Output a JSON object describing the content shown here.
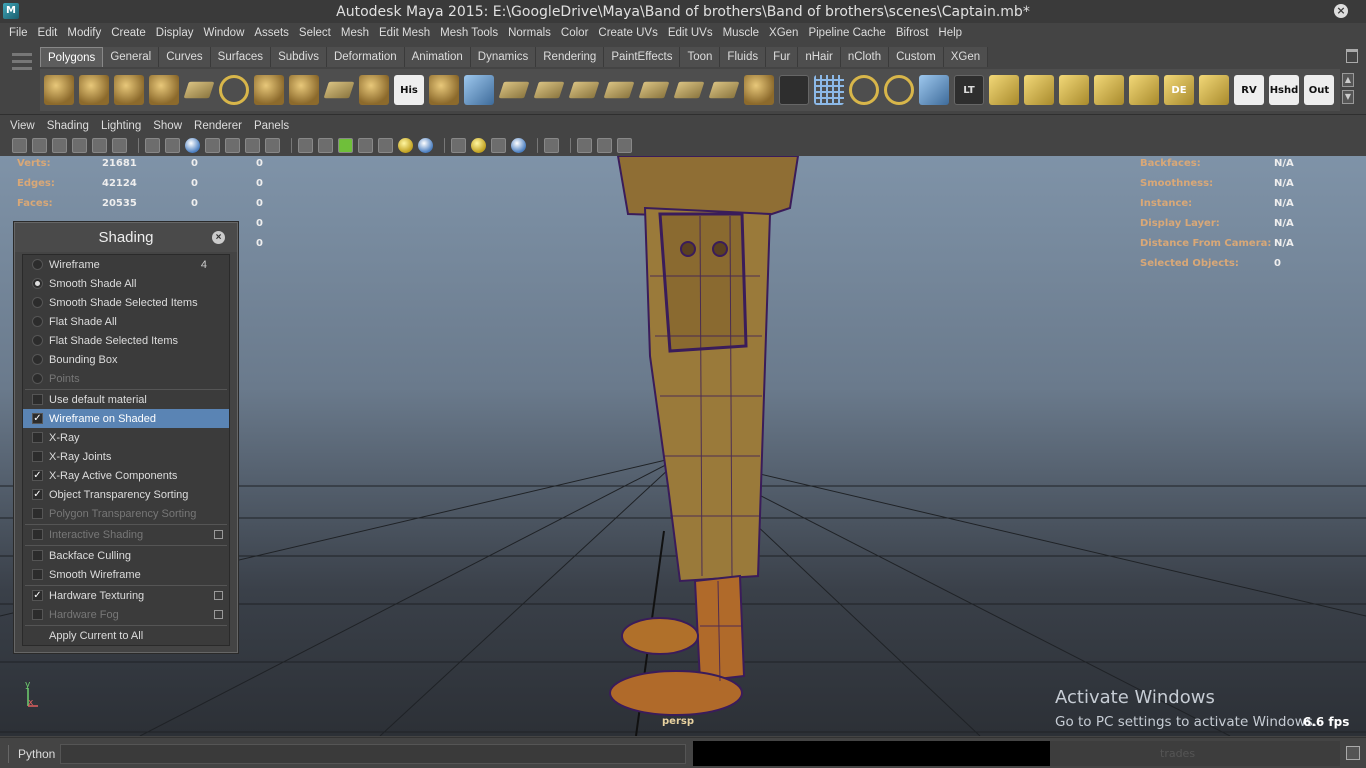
{
  "titlebar": {
    "title": "Autodesk Maya 2015: E:\\GoogleDrive\\Maya\\Band of brothers\\Band of brothers\\scenes\\Captain.mb*",
    "app_icon": "M"
  },
  "menubar": [
    "File",
    "Edit",
    "Modify",
    "Create",
    "Display",
    "Window",
    "Assets",
    "Select",
    "Mesh",
    "Edit Mesh",
    "Mesh Tools",
    "Normals",
    "Color",
    "Create UVs",
    "Edit UVs",
    "Muscle",
    "XGen",
    "Pipeline Cache",
    "Bifrost",
    "Help"
  ],
  "shelf": {
    "tabs": [
      "Polygons",
      "General",
      "Curves",
      "Surfaces",
      "Subdivs",
      "Deformation",
      "Animation",
      "Dynamics",
      "Rendering",
      "PaintEffects",
      "Toon",
      "Fluids",
      "Fur",
      "nHair",
      "nCloth",
      "Custom",
      "XGen"
    ],
    "active_tab": "Polygons",
    "icons": [
      {
        "name": "poly-sphere-icon",
        "style": "shape",
        "label": ""
      },
      {
        "name": "poly-cube-icon",
        "style": "shape",
        "label": ""
      },
      {
        "name": "poly-cylinder-icon",
        "style": "shape",
        "label": ""
      },
      {
        "name": "poly-cone-icon",
        "style": "shape",
        "label": ""
      },
      {
        "name": "poly-plane-icon",
        "style": "flat",
        "label": ""
      },
      {
        "name": "poly-torus-icon",
        "style": "ring",
        "label": ""
      },
      {
        "name": "poly-pyramid-icon",
        "style": "shape",
        "label": ""
      },
      {
        "name": "poly-pipe-icon",
        "style": "shape",
        "label": ""
      },
      {
        "name": "poly-helix-icon",
        "style": "flat",
        "label": ""
      },
      {
        "name": "poly-soccer-ball-icon",
        "style": "shape",
        "label": ""
      },
      {
        "name": "history-icon",
        "style": "text",
        "label": "His"
      },
      {
        "name": "combine-icon",
        "style": "shape",
        "label": ""
      },
      {
        "name": "separate-icon",
        "style": "blue",
        "label": ""
      },
      {
        "name": "extract-icon",
        "style": "flat",
        "label": ""
      },
      {
        "name": "booleans-icon",
        "style": "flat",
        "label": ""
      },
      {
        "name": "smooth-icon",
        "style": "flat",
        "label": ""
      },
      {
        "name": "average-vertices-icon",
        "style": "flat",
        "label": ""
      },
      {
        "name": "transfer-icon",
        "style": "flat",
        "label": ""
      },
      {
        "name": "extrude-icon",
        "style": "flat",
        "label": ""
      },
      {
        "name": "bridge-icon",
        "style": "flat",
        "label": ""
      },
      {
        "name": "merge-icon",
        "style": "shape",
        "label": ""
      },
      {
        "name": "split-icon",
        "style": "dark",
        "label": ""
      },
      {
        "name": "grid-icon",
        "style": "grid",
        "label": ""
      },
      {
        "name": "snap-icon",
        "style": "ring",
        "label": ""
      },
      {
        "name": "rotate-icon",
        "style": "ring",
        "label": ""
      },
      {
        "name": "move-icon",
        "style": "blue",
        "label": ""
      },
      {
        "name": "lasso-tool-icon",
        "style": "dark",
        "label": "LT"
      },
      {
        "name": "uv-map-icon",
        "style": "gold",
        "label": ""
      },
      {
        "name": "uv-planar-icon",
        "style": "gold",
        "label": ""
      },
      {
        "name": "uv-cylinder-icon",
        "style": "gold",
        "label": ""
      },
      {
        "name": "uv-sphere-icon",
        "style": "gold",
        "label": ""
      },
      {
        "name": "uv-auto-icon",
        "style": "gold",
        "label": ""
      },
      {
        "name": "display-edges-icon",
        "style": "gold",
        "label": "DE"
      },
      {
        "name": "uv-layout-icon",
        "style": "gold",
        "label": ""
      },
      {
        "name": "reverse-normals-icon",
        "style": "text",
        "label": "RV"
      },
      {
        "name": "hard-shade-icon",
        "style": "text",
        "label": "Hshd"
      },
      {
        "name": "outliner-icon",
        "style": "text",
        "label": "Out"
      }
    ]
  },
  "panel_menu": [
    "View",
    "Shading",
    "Lighting",
    "Show",
    "Renderer",
    "Panels"
  ],
  "hud_left": [
    {
      "label": "Verts:",
      "v1": "21681",
      "v2": "0",
      "v3": "0"
    },
    {
      "label": "Edges:",
      "v1": "42124",
      "v2": "0",
      "v3": "0"
    },
    {
      "label": "Faces:",
      "v1": "20535",
      "v2": "0",
      "v3": "0"
    },
    {
      "label": "",
      "v1": "",
      "v2": "",
      "v3": "0"
    },
    {
      "label": "",
      "v1": "",
      "v2": "",
      "v3": "0"
    }
  ],
  "hud_right": [
    {
      "label": "Backfaces:",
      "value": "N/A"
    },
    {
      "label": "Smoothness:",
      "value": "N/A"
    },
    {
      "label": "Instance:",
      "value": "N/A"
    },
    {
      "label": "Display Layer:",
      "value": "N/A"
    },
    {
      "label": "Distance From Camera:",
      "value": "N/A"
    },
    {
      "label": "Selected Objects:",
      "value": "0"
    }
  ],
  "camera_label": "persp",
  "watermark": {
    "title": "Activate Windows",
    "subtitle": "Go to PC settings to activate Windows."
  },
  "fps": "6.6 fps",
  "axis": {
    "y": "y",
    "x": "x"
  },
  "shading_panel": {
    "title": "Shading",
    "items": [
      {
        "label": "Wireframe",
        "marker": "radio",
        "checked": false,
        "shortcut": "4",
        "disabled": false,
        "option_box": false
      },
      {
        "label": "Smooth Shade All",
        "marker": "radio",
        "checked": true,
        "shortcut": "",
        "disabled": false,
        "option_box": false
      },
      {
        "label": "Smooth Shade Selected Items",
        "marker": "radio",
        "checked": false,
        "shortcut": "",
        "disabled": false,
        "option_box": false
      },
      {
        "label": "Flat Shade All",
        "marker": "radio",
        "checked": false,
        "shortcut": "",
        "disabled": false,
        "option_box": false
      },
      {
        "label": "Flat Shade Selected Items",
        "marker": "radio",
        "checked": false,
        "shortcut": "",
        "disabled": false,
        "option_box": false
      },
      {
        "label": "Bounding Box",
        "marker": "radio",
        "checked": false,
        "shortcut": "",
        "disabled": false,
        "option_box": false
      },
      {
        "label": "Points",
        "marker": "radio",
        "checked": false,
        "shortcut": "",
        "disabled": true,
        "option_box": false,
        "sep_after": true
      },
      {
        "label": "Use default material",
        "marker": "box",
        "checked": false,
        "shortcut": "",
        "disabled": false,
        "option_box": false
      },
      {
        "label": "Wireframe on Shaded",
        "marker": "box",
        "checked": true,
        "shortcut": "",
        "disabled": false,
        "option_box": false,
        "selected": true
      },
      {
        "label": "X-Ray",
        "marker": "box",
        "checked": false,
        "shortcut": "",
        "disabled": false,
        "option_box": false
      },
      {
        "label": "X-Ray Joints",
        "marker": "box",
        "checked": false,
        "shortcut": "",
        "disabled": false,
        "option_box": false
      },
      {
        "label": "X-Ray Active Components",
        "marker": "box",
        "checked": true,
        "shortcut": "",
        "disabled": false,
        "option_box": false
      },
      {
        "label": "Object Transparency Sorting",
        "marker": "box",
        "checked": true,
        "shortcut": "",
        "disabled": false,
        "option_box": false
      },
      {
        "label": "Polygon Transparency Sorting",
        "marker": "box",
        "checked": false,
        "shortcut": "",
        "disabled": true,
        "option_box": false,
        "sep_after": true
      },
      {
        "label": "Interactive Shading",
        "marker": "box",
        "checked": false,
        "shortcut": "",
        "disabled": true,
        "option_box": true,
        "sep_after": true
      },
      {
        "label": "Backface Culling",
        "marker": "box",
        "checked": false,
        "shortcut": "",
        "disabled": false,
        "option_box": false
      },
      {
        "label": "Smooth Wireframe",
        "marker": "box",
        "checked": false,
        "shortcut": "",
        "disabled": false,
        "option_box": false,
        "sep_after": true
      },
      {
        "label": "Hardware Texturing",
        "marker": "box",
        "checked": true,
        "shortcut": "",
        "disabled": false,
        "option_box": true
      },
      {
        "label": "Hardware Fog",
        "marker": "box",
        "checked": false,
        "shortcut": "",
        "disabled": true,
        "option_box": true,
        "sep_after": true
      },
      {
        "label": "Apply Current to All",
        "marker": "none",
        "checked": false,
        "shortcut": "",
        "disabled": false,
        "option_box": false
      }
    ]
  },
  "command_line": {
    "language": "Python",
    "tray_label": "trades"
  },
  "colors": {
    "accent": "#5a84b4",
    "hud_label": "#d9a877",
    "model_fabric": "#9a7a3a",
    "wire": "#3a1c5a"
  }
}
